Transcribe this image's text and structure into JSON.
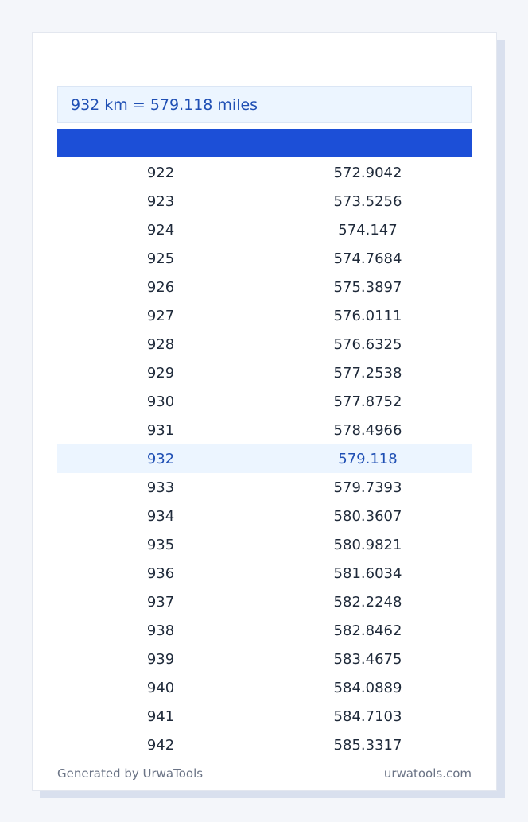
{
  "result": {
    "text": "932 km = 579.118 miles"
  },
  "table": {
    "rows": [
      {
        "km": "922",
        "miles": "572.9042"
      },
      {
        "km": "923",
        "miles": "573.5256"
      },
      {
        "km": "924",
        "miles": "574.147"
      },
      {
        "km": "925",
        "miles": "574.7684"
      },
      {
        "km": "926",
        "miles": "575.3897"
      },
      {
        "km": "927",
        "miles": "576.0111"
      },
      {
        "km": "928",
        "miles": "576.6325"
      },
      {
        "km": "929",
        "miles": "577.2538"
      },
      {
        "km": "930",
        "miles": "577.8752"
      },
      {
        "km": "931",
        "miles": "578.4966"
      },
      {
        "km": "932",
        "miles": "579.118"
      },
      {
        "km": "933",
        "miles": "579.7393"
      },
      {
        "km": "934",
        "miles": "580.3607"
      },
      {
        "km": "935",
        "miles": "580.9821"
      },
      {
        "km": "936",
        "miles": "581.6034"
      },
      {
        "km": "937",
        "miles": "582.2248"
      },
      {
        "km": "938",
        "miles": "582.8462"
      },
      {
        "km": "939",
        "miles": "583.4675"
      },
      {
        "km": "940",
        "miles": "584.0889"
      },
      {
        "km": "941",
        "miles": "584.7103"
      },
      {
        "km": "942",
        "miles": "585.3317"
      }
    ]
  },
  "footer": {
    "generated_by": "Generated by UrwaTools",
    "site": "urwatools.com"
  },
  "colors": {
    "header": "#1c4fd7",
    "highlight_bg": "#ecf5ff",
    "highlight_text": "#1f4fb4"
  }
}
